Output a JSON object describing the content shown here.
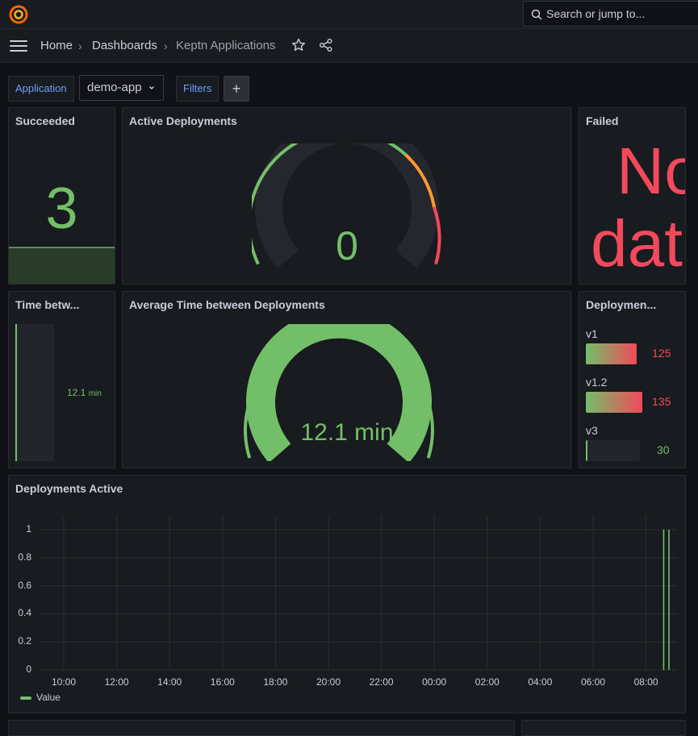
{
  "topbar": {
    "search_placeholder": "Search or jump to...",
    "logo": "grafana-logo"
  },
  "breadcrumb": {
    "home": "Home",
    "dashboards": "Dashboards",
    "current": "Keptn Applications"
  },
  "variables": {
    "application_label": "Application",
    "application_value": "demo-app",
    "filters_label": "Filters",
    "add_label": "+"
  },
  "panels": {
    "succeeded": {
      "title": "Succeeded",
      "value": "3"
    },
    "active_deployments": {
      "title": "Active Deployments",
      "value": "0"
    },
    "failed": {
      "title": "Failed",
      "line1": "No",
      "line2": "data"
    },
    "time_between": {
      "title": "Time betw...",
      "value": "12.1",
      "unit": "min",
      "level": 0.0
    },
    "avg_time": {
      "title": "Average Time between Deployments",
      "value": "12.1 min",
      "level": 1.0
    },
    "deployment_versions": {
      "title": "Deploymen...",
      "items": [
        {
          "label": "v1",
          "value": "125",
          "fill": 0.8,
          "color": "#f2495c"
        },
        {
          "label": "v1.2",
          "value": "135",
          "fill": 0.9,
          "color": "#f2495c"
        },
        {
          "label": "v3",
          "value": "30",
          "fill": 0.02,
          "color": "#73bf69"
        }
      ]
    },
    "deployments_active": {
      "title": "Deployments Active"
    }
  },
  "chart_data": {
    "type": "line",
    "title": "Deployments Active",
    "x_ticks": [
      "10:00",
      "12:00",
      "14:00",
      "16:00",
      "18:00",
      "20:00",
      "22:00",
      "00:00",
      "02:00",
      "04:00",
      "06:00",
      "08:00"
    ],
    "y_ticks": [
      "0",
      "0.2",
      "0.4",
      "0.6",
      "0.8",
      "1"
    ],
    "ylim": [
      0,
      1
    ],
    "grid": true,
    "legend_position": "bottom-left",
    "series": [
      {
        "name": "Value",
        "color": "#73bf69",
        "points": [
          [
            "08:40",
            1
          ],
          [
            "08:52",
            1
          ]
        ]
      }
    ]
  }
}
